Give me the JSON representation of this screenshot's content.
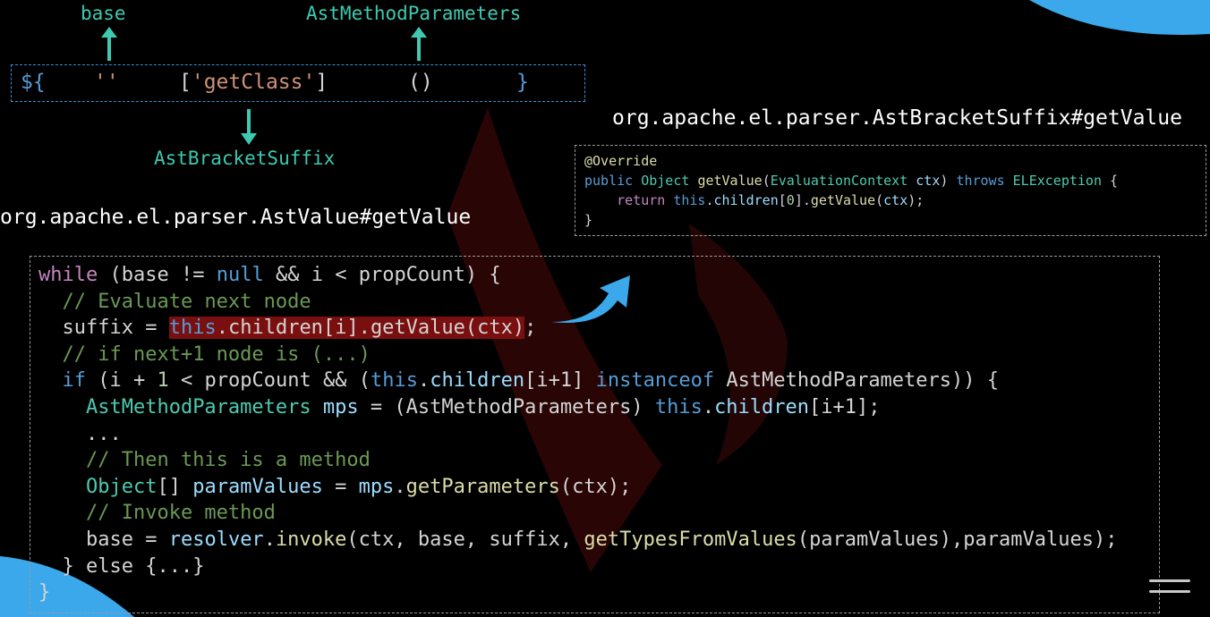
{
  "labels": {
    "base": "base",
    "ast_method_parameters": "AstMethodParameters",
    "ast_bracket_suffix": "AstBracketSuffix"
  },
  "expression": {
    "open": "${",
    "empty_string": "''",
    "bracket": "['getClass']",
    "bracket_open": "[",
    "bracket_string": "'getClass'",
    "bracket_close": "]",
    "parens": "()",
    "close": "}"
  },
  "titles": {
    "bracket_suffix": "org.apache.el.parser.AstBracketSuffix#getValue",
    "ast_value": "org.apache.el.parser.AstValue#getValue"
  },
  "snippet": {
    "annotation": "@Override",
    "signature": {
      "kw_public": "public",
      "type_object": "Object",
      "method": "getValue",
      "param_type": "EvaluationContext",
      "param_name": "ctx",
      "kw_throws": "throws",
      "exception": "ELException",
      "open_brace": "{"
    },
    "return_line": {
      "kw_return": "return",
      "kw_this": "this",
      "children": "children",
      "index": "0",
      "method": "getValue",
      "arg": "ctx"
    },
    "close_brace": "}"
  },
  "code": {
    "l1": {
      "kw_while": "while",
      "base": "base",
      "ne": "!=",
      "null": "null",
      "and": "&&",
      "i": "i",
      "lt": "<",
      "propCount": "propCount",
      "brace": "{"
    },
    "l2": {
      "comment": "// Evaluate next node"
    },
    "l3": {
      "suffix": "suffix",
      "eq": "=",
      "this": "this",
      "children": "children",
      "i": "i",
      "getValue": "getValue",
      "ctx": "ctx"
    },
    "l4": {
      "comment": "// if next+1 node is (...)"
    },
    "l5": {
      "kw_if": "if",
      "i": "i",
      "plus": "+",
      "one": "1",
      "lt": "<",
      "propCount": "propCount",
      "and": "&&",
      "this": "this",
      "children": "children",
      "index": "i+1",
      "instanceof": "instanceof",
      "type": "AstMethodParameters",
      "brace": "{"
    },
    "l6": {
      "type": "AstMethodParameters",
      "mps": "mps",
      "eq": "=",
      "cast": "AstMethodParameters",
      "this": "this",
      "children": "children",
      "index": "i+1"
    },
    "l7": {
      "ellipsis": "..."
    },
    "l8": {
      "comment": "// Then this is a method"
    },
    "l9": {
      "type": "Object",
      "paramValues": "paramValues",
      "eq": "=",
      "mps": "mps",
      "getParameters": "getParameters",
      "ctx": "ctx"
    },
    "l10": {
      "comment": "// Invoke method"
    },
    "l11": {
      "base": "base",
      "eq": "=",
      "resolver": "resolver",
      "invoke": "invoke",
      "ctx": "ctx",
      "base2": "base",
      "suffix": "suffix",
      "getTypesFromValues": "getTypesFromValues",
      "paramValues": "paramValues",
      "paramValues2": "paramValues"
    },
    "l12": {
      "else_text": "} else {...}"
    },
    "l13": {
      "brace": "}"
    }
  },
  "colors": {
    "teal": "#3ec9b0",
    "dash_blue": "#3a8fd6",
    "highlight": "#7a0f0f",
    "accent_blue": "#3aa8ea"
  },
  "icons": [
    "hamburger-menu-icon",
    "curved-arrow-icon",
    "up-arrow-icon",
    "down-arrow-icon"
  ]
}
